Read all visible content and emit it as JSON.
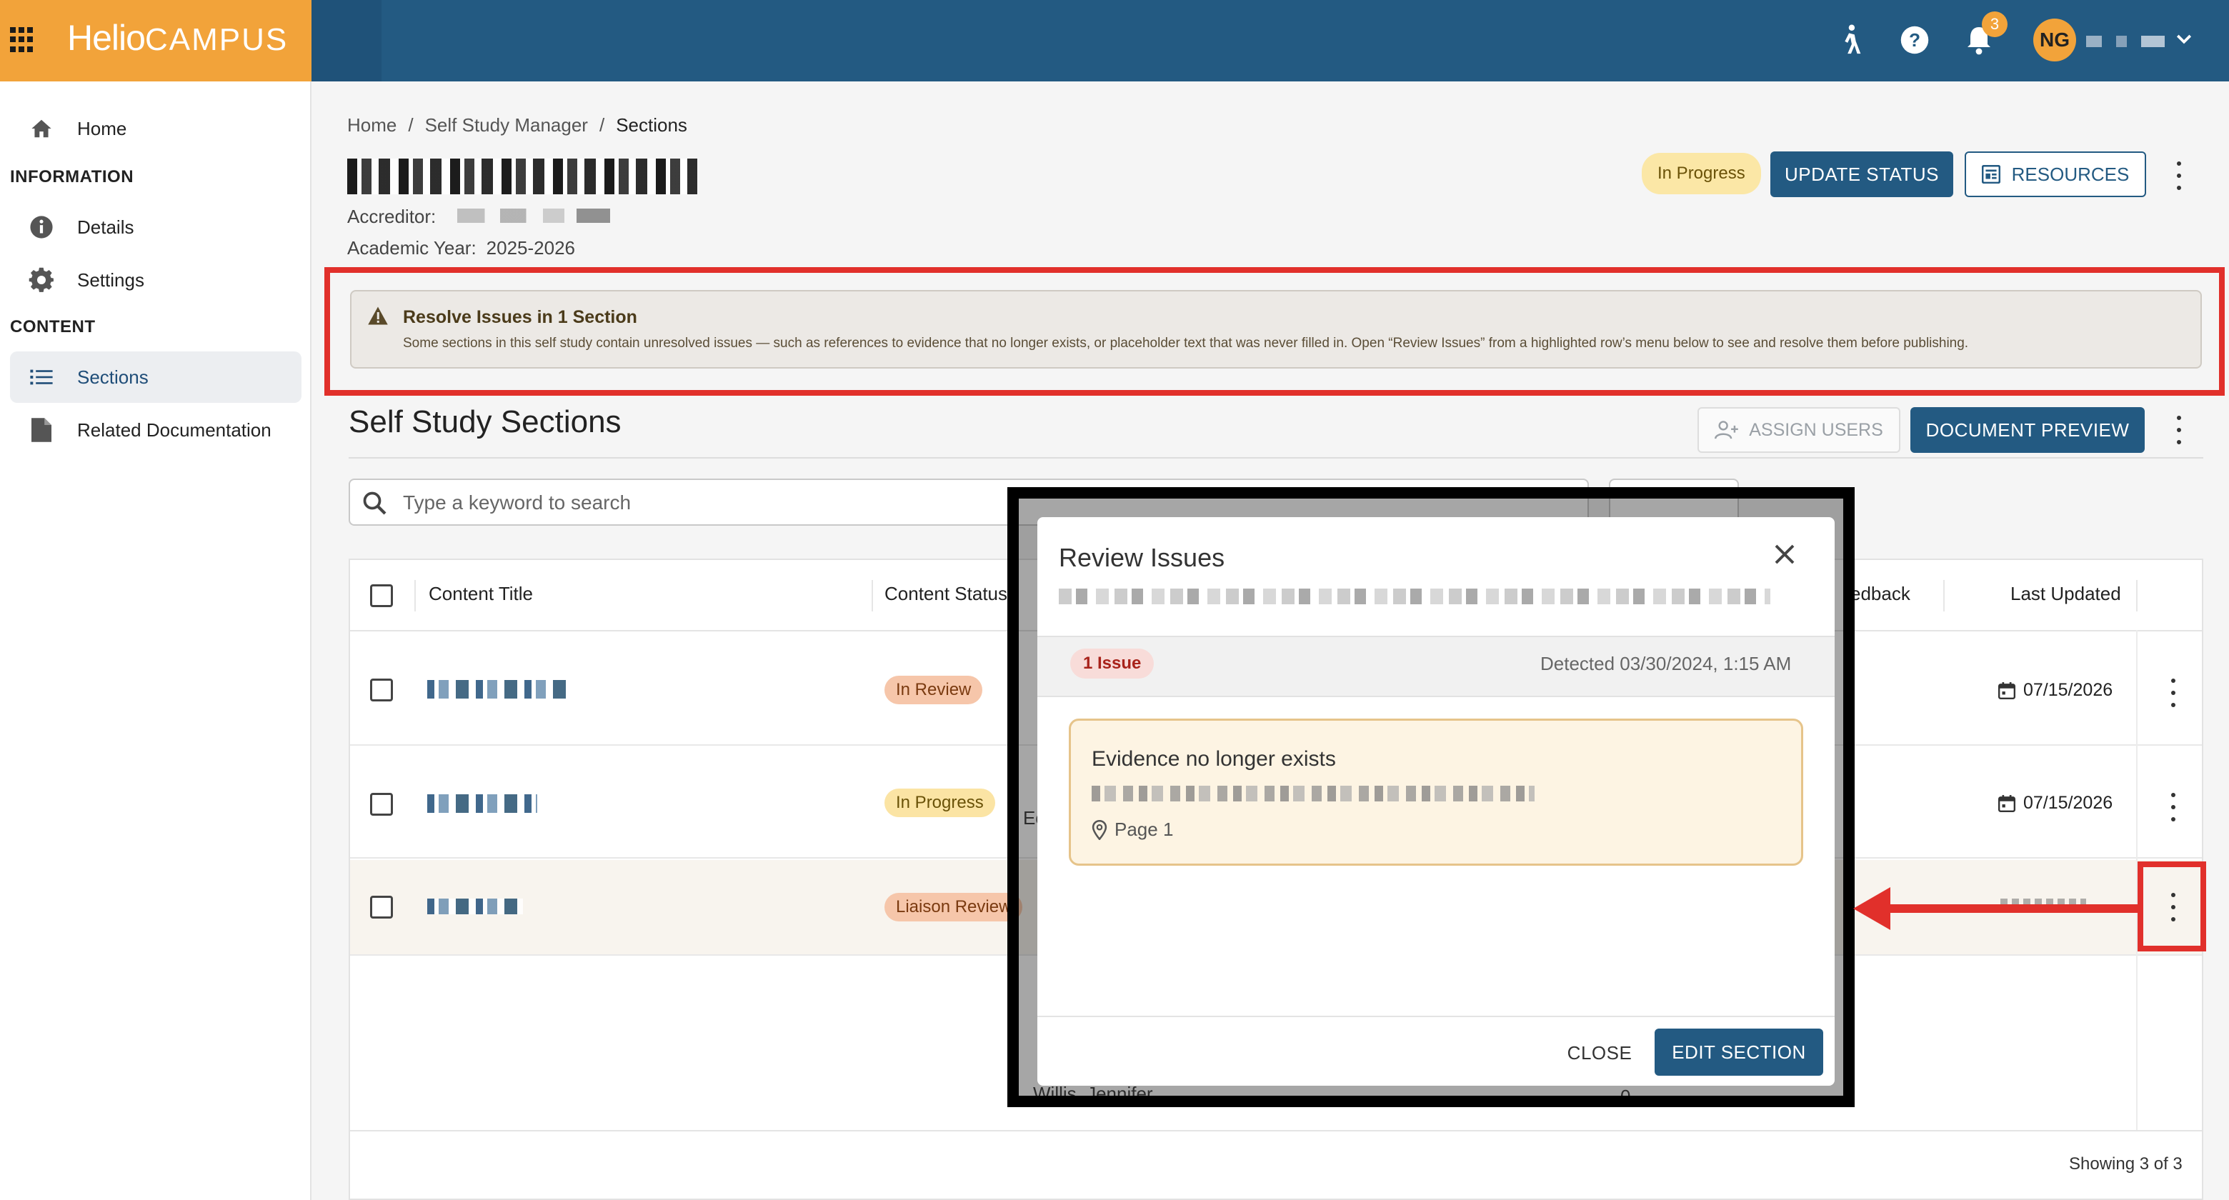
{
  "app": {
    "logo_primary": "Helio",
    "logo_secondary": "CAMPUS",
    "notification_count": "3",
    "user_initials": "NG"
  },
  "sidebar": {
    "home": "Home",
    "information_header": "INFORMATION",
    "details": "Details",
    "settings": "Settings",
    "content_header": "CONTENT",
    "sections": "Sections",
    "related_documentation": "Related Documentation"
  },
  "breadcrumb": {
    "home": "Home",
    "sep": "/",
    "manager": "Self Study Manager",
    "current": "Sections"
  },
  "header": {
    "accreditor_label": "Accreditor:",
    "year_label": "Academic Year:",
    "year_value": "2025-2026",
    "status": "In Progress",
    "update_status": "UPDATE STATUS",
    "resources": "RESOURCES"
  },
  "warning": {
    "title": "Resolve Issues in 1 Section",
    "text": "Some sections in this self study contain unresolved issues — such as references to evidence that no longer exists, or placeholder text that was never filled in. Open “Review Issues” from a highlighted row’s menu below to see and resolve them before publishing."
  },
  "sections": {
    "title": "Self Study Sections",
    "assign_users": "ASSIGN USERS",
    "document_preview": "DOCUMENT PREVIEW",
    "search_placeholder": "Type a keyword to search"
  },
  "table": {
    "col_title": "Content Title",
    "col_status": "Content Status",
    "col_feedback": "edback",
    "col_updated": "Last Updated",
    "rows": [
      {
        "status": "In Review",
        "updated": "07/15/2026"
      },
      {
        "status": "In Progress",
        "updated": "07/15/2026"
      },
      {
        "status": "Liaison Review",
        "updated": ""
      }
    ],
    "bg_partial_1": "Ec",
    "bg_partial_2": "Willis, Jennifer",
    "bg_partial_3": "0",
    "footer": "Showing 3 of 3"
  },
  "modal": {
    "title": "Review Issues",
    "issue_count": "1 Issue",
    "detected": "Detected 03/30/2024, 1:15 AM",
    "issue_title": "Evidence no longer exists",
    "issue_location": "Page 1",
    "close": "CLOSE",
    "edit_section": "EDIT SECTION"
  },
  "colors": {
    "brand_blue": "#235a82",
    "brand_orange": "#f2a33a",
    "annotation_red": "#e1302b"
  }
}
